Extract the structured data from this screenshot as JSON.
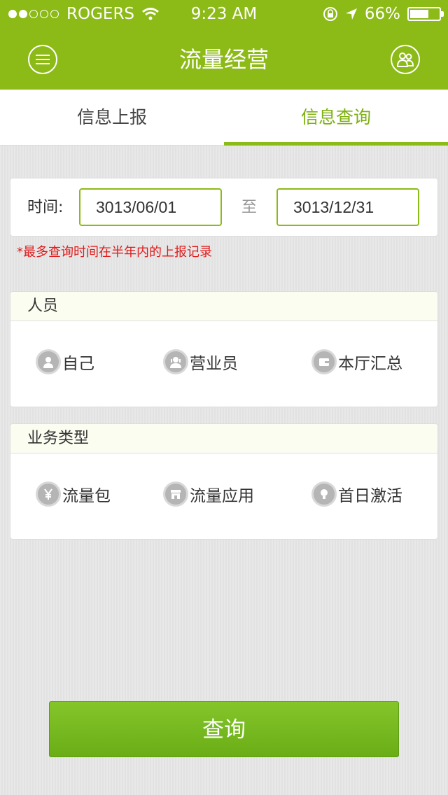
{
  "status_bar": {
    "carrier": "ROGERS",
    "time": "9:23 AM",
    "battery_text": "66%",
    "battery_level": 0.66,
    "signal_filled": 2,
    "signal_total": 5
  },
  "nav": {
    "title": "流量经营",
    "menu_icon": "menu-icon",
    "users_icon": "users-icon"
  },
  "tabs": [
    {
      "label": "信息上报",
      "active": false
    },
    {
      "label": "信息查询",
      "active": true
    }
  ],
  "time_filter": {
    "label": "时间:",
    "from_date": "3013/06/01",
    "to_label": "至",
    "to_date": "3013/12/31",
    "note": "*最多查询时间在半年内的上报记录"
  },
  "people_section": {
    "title": "人员",
    "options": [
      {
        "label": "自己",
        "icon": "person-icon"
      },
      {
        "label": "营业员",
        "icon": "staff-icon"
      },
      {
        "label": "本厅汇总",
        "icon": "wallet-icon"
      }
    ]
  },
  "business_section": {
    "title": "业务类型",
    "options": [
      {
        "label": "流量包",
        "icon": "yen-icon"
      },
      {
        "label": "流量应用",
        "icon": "store-icon"
      },
      {
        "label": "首日激活",
        "icon": "bulb-icon"
      }
    ]
  },
  "query_button": {
    "label": "查询"
  },
  "colors": {
    "primary_green": "#8cba17",
    "accent_text_green": "#7cb00e",
    "button_green": "#6fb31c",
    "note_red": "#e21a1a",
    "icon_gray": "#b5b5b5"
  }
}
